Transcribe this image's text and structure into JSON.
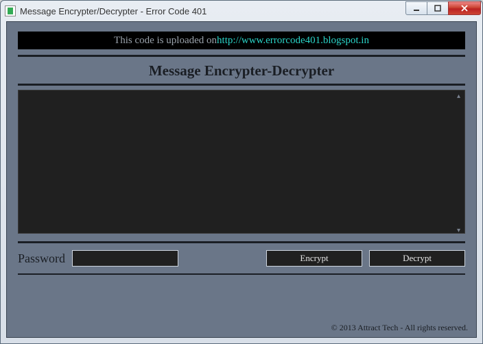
{
  "window": {
    "title": "Message Encrypter/Decrypter - Error Code 401"
  },
  "banner": {
    "prefix": "This code is uploaded on ",
    "link": "http://www.errorcode401.blogspot.in"
  },
  "heading": "Message Encrypter-Decrypter",
  "message": {
    "value": ""
  },
  "password": {
    "label": "Password",
    "value": ""
  },
  "buttons": {
    "encrypt": "Encrypt",
    "decrypt": "Decrypt"
  },
  "footer": {
    "copyright": "© 2013 Attract Tech - All rights reserved."
  }
}
